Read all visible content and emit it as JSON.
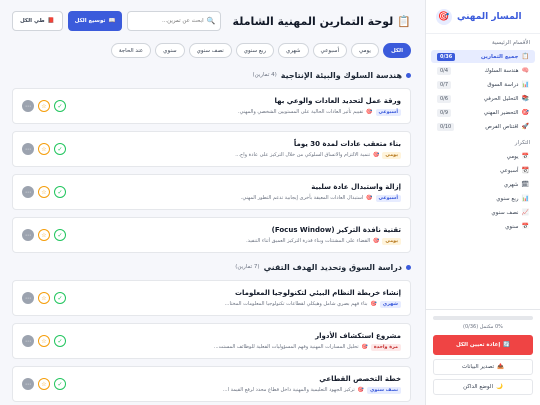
{
  "sidebar": {
    "brand_title": "المسار المهني",
    "brand_icon": "target-icon",
    "section_main": "الأقسام الرئيسية",
    "main_items": [
      {
        "label": "جميع التمارين",
        "count": "0/36",
        "icon": "📋",
        "active": true
      },
      {
        "label": "هندسة السلوك",
        "count": "0/4",
        "icon": "🧠"
      },
      {
        "label": "دراسة السوق",
        "count": "0/7",
        "icon": "📊"
      },
      {
        "label": "التحليل الحرفي",
        "count": "0/6",
        "icon": "📚"
      },
      {
        "label": "التحضير المهني",
        "count": "0/9",
        "icon": "🎯"
      },
      {
        "label": "اقتناص الفرص",
        "count": "0/10",
        "icon": "🚀"
      }
    ],
    "section_freq": "التكرار",
    "freq_items": [
      {
        "label": "يومي",
        "icon": "📅"
      },
      {
        "label": "أسبوعي",
        "icon": "📆"
      },
      {
        "label": "شهري",
        "icon": "🗓"
      },
      {
        "label": "ربع سنوي",
        "icon": "📊"
      },
      {
        "label": "نصف سنوي",
        "icon": "📈"
      },
      {
        "label": "سنوي",
        "icon": "📅"
      }
    ],
    "progress_percent": 0,
    "progress_text": "0% مكتمل (0/36)",
    "reset_label": "إعادة تعيين الكل",
    "export_label": "تصدير البيانات",
    "dark_label": "الوضع الداكن"
  },
  "header": {
    "title": "لوحة التمارين المهنية الشاملة",
    "title_icon": "clipboard-icon",
    "search_placeholder": "ابحث عن تمرين...",
    "expand_label": "توسيع الكل",
    "collapse_label": "طي الكل"
  },
  "filters": [
    "الكل",
    "يومي",
    "أسبوعي",
    "شهري",
    "ربع سنوي",
    "نصف سنوي",
    "سنوي",
    "عند الحاجة"
  ],
  "groups": [
    {
      "title": "هندسة السلوك والبيئة الإنتاجية",
      "count": "(4 تمارين)",
      "items": [
        {
          "title": "ورقة عمل لتحديد العادات والوعي بها",
          "tag": "أسبوعي",
          "tag_type": "weekly",
          "desc": "تقييم تأثير العادات الحالية على المستويين الشخصي والمهني."
        },
        {
          "title": "بناء متعقب عادات لمدة 30 يوماً",
          "tag": "يومي",
          "tag_type": "daily",
          "desc": "تنمية الالتزام والاتساق السلوكي من خلال التركيز على عادة واح..."
        },
        {
          "title": "إزالة واستبدال عادة سلبية",
          "tag": "أسبوعي",
          "tag_type": "weekly",
          "desc": "استبدال العادات المعيقة بأخرى إيجابية تدعم التطور المهني."
        },
        {
          "title": "تقنية نافذة التركيز (Focus Window)",
          "tag": "يومي",
          "tag_type": "daily",
          "desc": "القضاء على المشتتات وبناء قدرة التركيز العميق أثناء التنفيذ."
        }
      ]
    },
    {
      "title": "دراسة السوق وتحديد الهدف التقني",
      "count": "(7 تمارين)",
      "items": [
        {
          "title": "إنشاء خريطة النظام البيئي لتكنولوجيا المعلومات",
          "tag": "شهري",
          "tag_type": "weekly",
          "desc": "بناء فهم بصري شامل وهيكلي لقطاعات تكنولوجيا المعلومات المختا..."
        },
        {
          "title": "مشروع استكشاف الأدوار",
          "tag": "مرة واحدة",
          "tag_type": "once",
          "desc": "تحليل المسارات المهنية وفهم المسؤوليات الفعلية للوظائف المستت..."
        },
        {
          "title": "خطة التخصص القطاعي",
          "tag": "نصف سنوي",
          "tag_type": "weekly",
          "desc": "تركيز الجهود التعليمية والمهنية داخل قطاع محدد لرفع القيمة ا..."
        }
      ]
    }
  ]
}
